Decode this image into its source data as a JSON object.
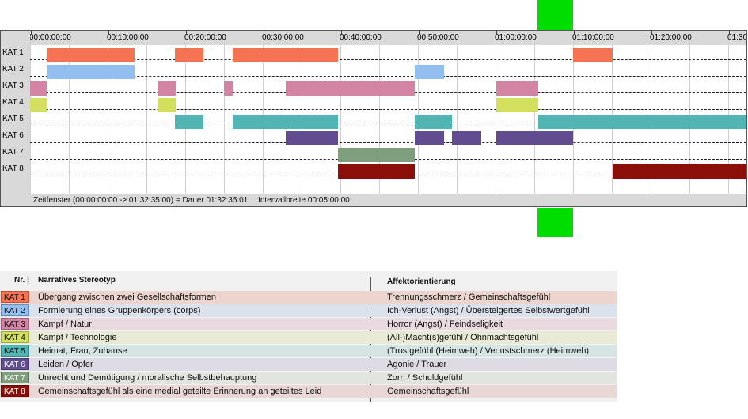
{
  "marker_color": "#00dd00",
  "ruler": {
    "ticks": [
      "00:00:00:00",
      "00:10:00:00",
      "00:20:00:00",
      "00:30:00:00",
      "00:40:00:00",
      "00:50:00:00",
      "01:00:00:00",
      "01:10:00:00",
      "01:20:00:00",
      "01:30"
    ],
    "tick_minutes": [
      0,
      10,
      20,
      30,
      40,
      50,
      60,
      70,
      80,
      90
    ],
    "range_minutes": [
      0,
      92.58
    ]
  },
  "categories": [
    {
      "id": "KAT 1",
      "color": "#f47352",
      "segments": [
        [
          2.1,
          13.4
        ],
        [
          18.7,
          22.4
        ],
        [
          26.1,
          39.7
        ],
        [
          70.0,
          75.1
        ]
      ]
    },
    {
      "id": "KAT 2",
      "color": "#92bff0",
      "segments": [
        [
          2.1,
          13.4
        ],
        [
          49.6,
          53.4
        ]
      ]
    },
    {
      "id": "KAT 3",
      "color": "#d383a4",
      "segments": [
        [
          0,
          2.1
        ],
        [
          16.5,
          18.7
        ],
        [
          25.0,
          26.1
        ],
        [
          33.0,
          49.6
        ],
        [
          60.1,
          65.5
        ]
      ]
    },
    {
      "id": "KAT 4",
      "color": "#d3e05e",
      "segments": [
        [
          0,
          2.1
        ],
        [
          16.5,
          18.7
        ],
        [
          60.1,
          65.5
        ]
      ]
    },
    {
      "id": "KAT 5",
      "color": "#51b5b3",
      "segments": [
        [
          18.7,
          22.4
        ],
        [
          26.1,
          39.7
        ],
        [
          49.6,
          54.4
        ],
        [
          65.5,
          92.58
        ]
      ]
    },
    {
      "id": "KAT 6",
      "color": "#614c90",
      "segments": [
        [
          33.0,
          39.7
        ],
        [
          49.6,
          53.4
        ],
        [
          54.4,
          58.2
        ],
        [
          60.1,
          70.0
        ]
      ]
    },
    {
      "id": "KAT 7",
      "color": "#7e9e7e",
      "segments": [
        [
          39.7,
          49.6
        ]
      ]
    },
    {
      "id": "KAT 8",
      "color": "#8b0e08",
      "segments": [
        [
          39.7,
          49.6
        ],
        [
          75.1,
          92.58
        ]
      ]
    }
  ],
  "status": {
    "window": "Zeitfenster (00:00:00:00 -> 01:32:35:00) = Dauer 01:32:35:01",
    "interval": "Intervallbreite 00:05:00:00"
  },
  "legend": {
    "col_nr": "Nr. |",
    "col_stereotype": "Narratives Stereotyp",
    "col_affect": "Affektorientierung",
    "rows": [
      {
        "kat": "KAT 1",
        "stereotype": "Übergang zwischen zwei Gesellschaftsformen",
        "affect": "Trennungsschmerz / Gemeinschaftsgefühl",
        "row_bg": "#ecd4cf"
      },
      {
        "kat": "KAT 2",
        "stereotype": "Formierung eines Gruppenkörpers (corps)",
        "affect": "Ich-Verlust (Angst) / Übersteigertes Selbstwertgefühl",
        "row_bg": "#dbe2ec"
      },
      {
        "kat": "KAT 3",
        "stereotype": "Kampf / Natur",
        "affect": "Horror (Angst) / Feindseligkeit",
        "row_bg": "#e9dadf"
      },
      {
        "kat": "KAT 4",
        "stereotype": "Kampf / Technologie",
        "affect": "(All-)Macht(s)gefühl / Ohnmachtsgefühl",
        "row_bg": "#e8ead6"
      },
      {
        "kat": "KAT 5",
        "stereotype": "Heimat, Frau, Zuhause",
        "affect": "(Trostgefühl (Heimweh) / Verlustschmerz (Heimweh)",
        "row_bg": "#d6e5e4"
      },
      {
        "kat": "KAT 6",
        "stereotype": "Leiden / Opfer",
        "affect": "Agonie / Trauer",
        "row_bg": "#dedbe4"
      },
      {
        "kat": "KAT 7",
        "stereotype": "Unrecht und Demütigung / moralische Selbstbehauptung",
        "affect": "Zorn / Schuldgefühl",
        "row_bg": "#e1e4df"
      },
      {
        "kat": "KAT 8",
        "stereotype": "Gemeinschaftsgefühl als eine medial geteilte Erinnerung an geteiltes Leid",
        "affect": "Gemeinschaftsgefühl",
        "row_bg": "#e9d7d6"
      }
    ]
  }
}
